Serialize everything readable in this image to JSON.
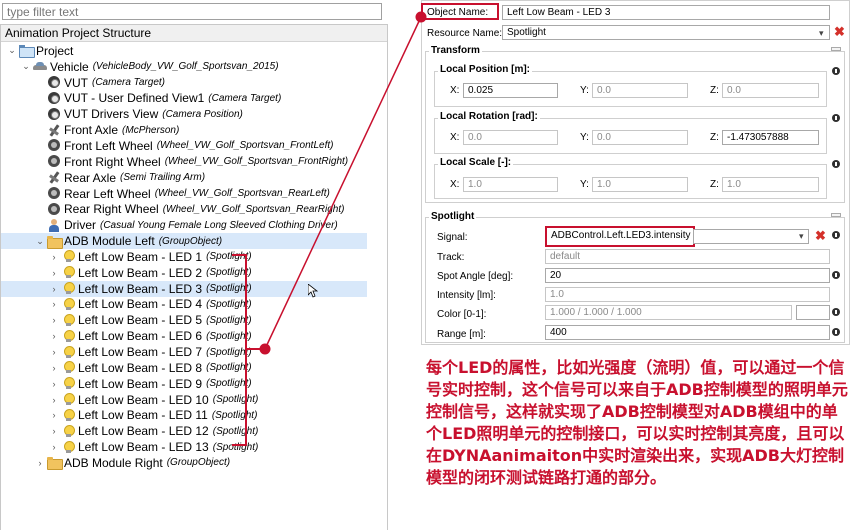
{
  "filter": {
    "placeholder": "type filter text"
  },
  "tree": {
    "header": "Animation Project Structure",
    "items": [
      {
        "label": "Project",
        "type": "",
        "indent": 0,
        "toggle": "v",
        "icon": "folder-open-icon"
      },
      {
        "label": "Vehicle",
        "type": "(VehicleBody_VW_Golf_Sportsvan_2015)",
        "indent": 1,
        "toggle": "v",
        "icon": "car-icon"
      },
      {
        "label": "VUT",
        "type": "(Camera Target)",
        "indent": 2,
        "toggle": "",
        "icon": "camera-icon"
      },
      {
        "label": "VUT - User Defined View1",
        "type": "(Camera Target)",
        "indent": 2,
        "toggle": "",
        "icon": "camera-icon"
      },
      {
        "label": "VUT Drivers View",
        "type": "(Camera Position)",
        "indent": 2,
        "toggle": "",
        "icon": "camera-icon"
      },
      {
        "label": "Front Axle",
        "type": "(McPherson)",
        "indent": 2,
        "toggle": "",
        "icon": "axle-icon"
      },
      {
        "label": "Front Left Wheel",
        "type": "(Wheel_VW_Golf_Sportsvan_FrontLeft)",
        "indent": 2,
        "toggle": "",
        "icon": "wheel-icon"
      },
      {
        "label": "Front Right Wheel",
        "type": "(Wheel_VW_Golf_Sportsvan_FrontRight)",
        "indent": 2,
        "toggle": "",
        "icon": "wheel-icon"
      },
      {
        "label": "Rear Axle",
        "type": "(Semi Trailing Arm)",
        "indent": 2,
        "toggle": "",
        "icon": "axle-icon"
      },
      {
        "label": "Rear Left Wheel",
        "type": "(Wheel_VW_Golf_Sportsvan_RearLeft)",
        "indent": 2,
        "toggle": "",
        "icon": "wheel-icon"
      },
      {
        "label": "Rear Right Wheel",
        "type": "(Wheel_VW_Golf_Sportsvan_RearRight)",
        "indent": 2,
        "toggle": "",
        "icon": "wheel-icon"
      },
      {
        "label": "Driver",
        "type": "(Casual Young Female Long Sleeved Clothing Driver)",
        "indent": 2,
        "toggle": "",
        "icon": "driver-icon"
      },
      {
        "label": "ADB Module Left",
        "type": "(GroupObject)",
        "indent": 2,
        "toggle": "v",
        "icon": "folder-icon",
        "selected": true
      },
      {
        "label": "Left Low Beam - LED 1",
        "type": "(Spotlight)",
        "indent": 3,
        "toggle": ">",
        "icon": "bulb-icon"
      },
      {
        "label": "Left Low Beam - LED 2",
        "type": "(Spotlight)",
        "indent": 3,
        "toggle": ">",
        "icon": "bulb-icon"
      },
      {
        "label": "Left Low Beam - LED 3",
        "type": "(Spotlight)",
        "indent": 3,
        "toggle": ">",
        "icon": "bulb-icon",
        "selected": true
      },
      {
        "label": "Left Low Beam - LED 4",
        "type": "(Spotlight)",
        "indent": 3,
        "toggle": ">",
        "icon": "bulb-icon"
      },
      {
        "label": "Left Low Beam - LED 5",
        "type": "(Spotlight)",
        "indent": 3,
        "toggle": ">",
        "icon": "bulb-icon"
      },
      {
        "label": "Left Low Beam - LED 6",
        "type": "(Spotlight)",
        "indent": 3,
        "toggle": ">",
        "icon": "bulb-icon"
      },
      {
        "label": "Left Low Beam - LED 7",
        "type": "(Spotlight)",
        "indent": 3,
        "toggle": ">",
        "icon": "bulb-icon"
      },
      {
        "label": "Left Low Beam - LED 8",
        "type": "(Spotlight)",
        "indent": 3,
        "toggle": ">",
        "icon": "bulb-icon"
      },
      {
        "label": "Left Low Beam - LED 9",
        "type": "(Spotlight)",
        "indent": 3,
        "toggle": ">",
        "icon": "bulb-icon"
      },
      {
        "label": "Left Low Beam - LED 10",
        "type": "(Spotlight)",
        "indent": 3,
        "toggle": ">",
        "icon": "bulb-icon"
      },
      {
        "label": "Left Low Beam - LED 11",
        "type": "(Spotlight)",
        "indent": 3,
        "toggle": ">",
        "icon": "bulb-icon"
      },
      {
        "label": "Left Low Beam - LED 12",
        "type": "(Spotlight)",
        "indent": 3,
        "toggle": ">",
        "icon": "bulb-icon"
      },
      {
        "label": "Left Low Beam - LED 13",
        "type": "(Spotlight)",
        "indent": 3,
        "toggle": ">",
        "icon": "bulb-icon"
      },
      {
        "label": "ADB Module Right",
        "type": "(GroupObject)",
        "indent": 2,
        "toggle": ">",
        "icon": "folder-icon"
      }
    ]
  },
  "properties": {
    "object_name_label": "Object Name:",
    "object_name_value": "Left Low Beam - LED 3",
    "resource_name_label": "Resource Name:",
    "resource_name_value": "Spotlight",
    "transform": {
      "title": "Transform",
      "local_position": {
        "title": "Local Position [m]:",
        "x_label": "X:",
        "x": "0.025",
        "y_label": "Y:",
        "y": "0.0",
        "z_label": "Z:",
        "z": "0.0"
      },
      "local_rotation": {
        "title": "Local Rotation [rad]:",
        "x_label": "X:",
        "x": "0.0",
        "y_label": "Y:",
        "y": "0.0",
        "z_label": "Z:",
        "z": "-1.473057888"
      },
      "local_scale": {
        "title": "Local Scale [-]:",
        "x_label": "X:",
        "x": "1.0",
        "y_label": "Y:",
        "y": "1.0",
        "z_label": "Z:",
        "z": "1.0"
      }
    },
    "spotlight": {
      "title": "Spotlight",
      "signal_label": "Signal:",
      "signal_value": "ADBControl.Left.LED3.intensity",
      "track_label": "Track:",
      "track_value": "default",
      "spot_angle_label": "Spot Angle [deg]:",
      "spot_angle_value": "20",
      "intensity_label": "Intensity [lm]:",
      "intensity_value": "1.0",
      "color_label": "Color [0-1]:",
      "color_value": "1.000 / 1.000 / 1.000",
      "range_label": "Range [m]:",
      "range_value": "400"
    }
  },
  "annotation": {
    "text": "每个LED的属性，比如光强度（流明）值，可以通过一个信号实时控制，这个信号可以来自于ADB控制模型的照明单元控制信号，这样就实现了ADB控制模型对ADB模组中的单个LED照明单元的控制接口，可以实时控制其亮度，且可以在DYNAanimaiton中实时渲染出来，实现ADB大灯控制模型的闭环测试链路打通的部分。"
  },
  "colors": {
    "accent": "#c8102e",
    "selection": "#d8e8fa"
  }
}
